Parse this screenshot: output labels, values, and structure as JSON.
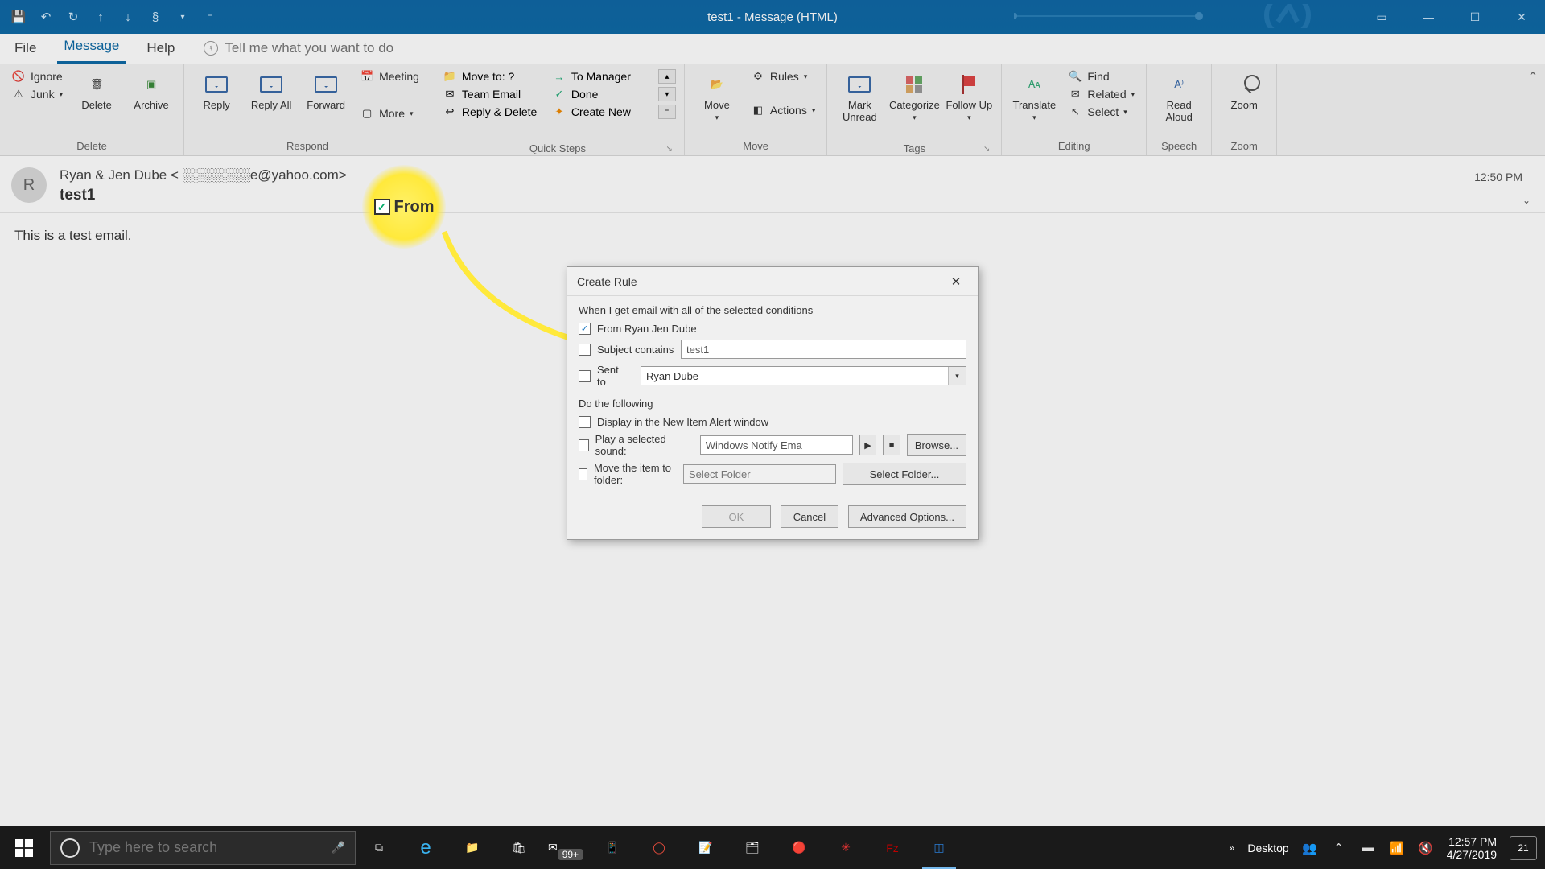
{
  "titlebar": {
    "title": "test1  -  Message (HTML)"
  },
  "tabs": {
    "file": "File",
    "message": "Message",
    "help": "Help",
    "tell_me": "Tell me what you want to do"
  },
  "ribbon": {
    "delete": {
      "ignore": "Ignore",
      "junk": "Junk",
      "delete": "Delete",
      "archive": "Archive",
      "label": "Delete"
    },
    "respond": {
      "reply": "Reply",
      "reply_all": "Reply All",
      "forward": "Forward",
      "meeting": "Meeting",
      "more": "More",
      "label": "Respond"
    },
    "quick_steps": {
      "c1a": "Move to: ?",
      "c1b": "Team Email",
      "c1c": "Reply & Delete",
      "c2a": "To Manager",
      "c2b": "Done",
      "c2c": "Create New",
      "label": "Quick Steps"
    },
    "move": {
      "move": "Move",
      "rules": "Rules",
      "actions": "Actions",
      "label": "Move"
    },
    "tags": {
      "mark_unread": "Mark Unread",
      "categorize": "Categorize",
      "follow_up": "Follow Up",
      "label": "Tags"
    },
    "editing": {
      "translate": "Translate",
      "find": "Find",
      "related": "Related",
      "select": "Select",
      "label": "Editing"
    },
    "speech": {
      "read_aloud": "Read Aloud",
      "label": "Speech"
    },
    "zoom": {
      "zoom": "Zoom",
      "label": "Zoom"
    }
  },
  "message": {
    "avatar_initial": "R",
    "sender": "Ryan & Jen Dube < ░░░░░░░e@yahoo.com>",
    "subject": "test1",
    "time": "12:50 PM",
    "body": "This is a test email."
  },
  "callout": {
    "label": "From"
  },
  "dialog": {
    "title": "Create Rule",
    "section1": "When I get email with all of the selected conditions",
    "from": "From Ryan  Jen Dube",
    "subject_contains": "Subject contains",
    "subject_value": "test1",
    "sent_to": "Sent to",
    "sent_to_value": "Ryan Dube",
    "section2": "Do the following",
    "display_alert": "Display in the New Item Alert window",
    "play_sound": "Play a selected sound:",
    "sound_value": "Windows Notify Ema",
    "browse": "Browse...",
    "move_item": "Move the item to folder:",
    "folder_placeholder": "Select Folder",
    "select_folder": "Select Folder...",
    "ok": "OK",
    "cancel": "Cancel",
    "advanced": "Advanced Options..."
  },
  "taskbar": {
    "search_placeholder": "Type here to search",
    "desktop": "Desktop",
    "time": "12:57 PM",
    "date": "4/27/2019",
    "notif_count": "21",
    "mail_badge": "99+"
  }
}
